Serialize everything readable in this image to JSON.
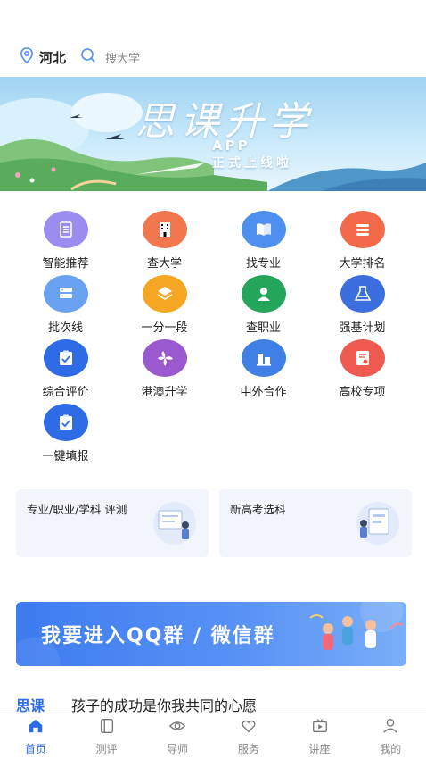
{
  "header": {
    "location": "河北",
    "search_placeholder": "搜大学"
  },
  "banner": {
    "title": "思课升学",
    "sub1": "APP",
    "sub2": "正式上线啦"
  },
  "features": [
    {
      "label": "智能推荐",
      "icon": "list-icon",
      "color": "#9b8cf0"
    },
    {
      "label": "查大学",
      "icon": "building-icon",
      "color": "#f2774f"
    },
    {
      "label": "找专业",
      "icon": "book-icon",
      "color": "#4f8ff0"
    },
    {
      "label": "大学排名",
      "icon": "ranking-icon",
      "color": "#f26a4a"
    },
    {
      "label": "批次线",
      "icon": "server-icon",
      "color": "#6aa2f2"
    },
    {
      "label": "一分一段",
      "icon": "layers-icon",
      "color": "#f5a623"
    },
    {
      "label": "查职业",
      "icon": "person-icon",
      "color": "#23a55a"
    },
    {
      "label": "强基计划",
      "icon": "flask-icon",
      "color": "#3b6fe0"
    },
    {
      "label": "综合评价",
      "icon": "clipboard-check-icon",
      "color": "#2f6be6"
    },
    {
      "label": "港澳升学",
      "icon": "bauhinia-icon",
      "color": "#9b59d0"
    },
    {
      "label": "中外合作",
      "icon": "handshake-building-icon",
      "color": "#3f7fe6"
    },
    {
      "label": "高校专项",
      "icon": "certificate-icon",
      "color": "#ee5a4f"
    },
    {
      "label": "一键填报",
      "icon": "clipboard-check-icon",
      "color": "#2f6be6"
    }
  ],
  "cards": [
    {
      "text": "专业/职业/学科 评测"
    },
    {
      "text": "新高考选科"
    }
  ],
  "promo": {
    "text": "我要进入QQ群 / 微信群"
  },
  "slogan": {
    "logo": "思课",
    "text": "孩子的成功是你我共同的心愿"
  },
  "tabbar": [
    {
      "label": "首页",
      "icon": "home-icon",
      "active": true
    },
    {
      "label": "测评",
      "icon": "test-icon",
      "active": false
    },
    {
      "label": "导师",
      "icon": "eye-icon",
      "active": false
    },
    {
      "label": "服务",
      "icon": "heart-hands-icon",
      "active": false
    },
    {
      "label": "讲座",
      "icon": "video-icon",
      "active": false
    },
    {
      "label": "我的",
      "icon": "user-icon",
      "active": false
    }
  ],
  "colors": {
    "accent": "#2f6be6",
    "muted": "#888888"
  }
}
